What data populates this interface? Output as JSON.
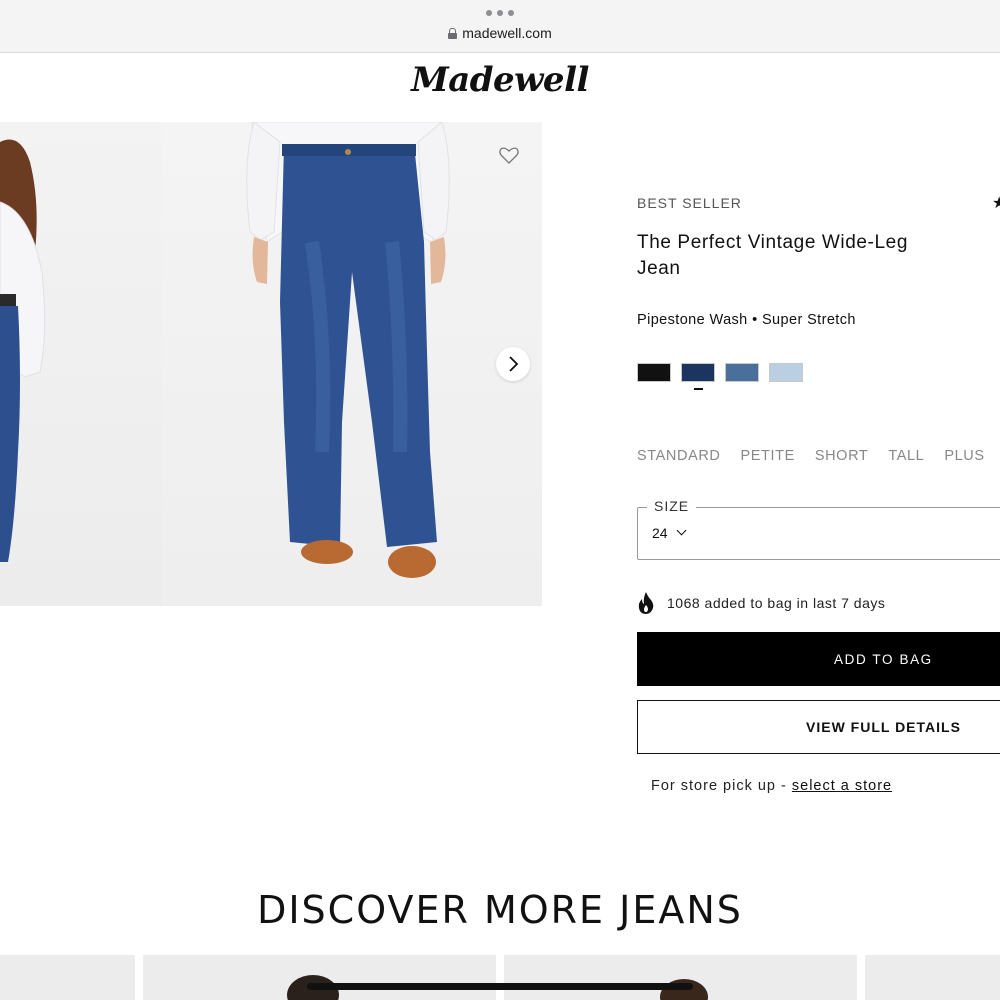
{
  "browser": {
    "url": "madewell.com",
    "menu_icon": "more-dots-icon",
    "lock_icon": "lock-icon"
  },
  "brand": {
    "logo": "Madewell"
  },
  "gallery": {
    "favorite_icon": "heart-icon",
    "next_icon": "chevron-right-icon"
  },
  "product": {
    "badge": "BEST SELLER",
    "title": "The Perfect Vintage Wide-Leg Jean",
    "subtitle": "Pipestone Wash • Super Stretch",
    "swatches": [
      {
        "color": "#111111",
        "selected": false
      },
      {
        "color": "#1c3560",
        "selected": true
      },
      {
        "color": "#4a6f9a",
        "selected": false
      },
      {
        "color": "#b9cfe2",
        "selected": false
      }
    ],
    "fits": [
      "STANDARD",
      "PETITE",
      "SHORT",
      "TALL",
      "PLUS"
    ],
    "size": {
      "label": "SIZE",
      "value": "24"
    },
    "popularity": "1068 added to bag in last 7 days",
    "add_to_bag": "ADD TO BAG",
    "view_details": "VIEW FULL DETAILS",
    "store_prefix": "For store pick up - ",
    "store_link": "select a store"
  },
  "discover": {
    "heading": "DISCOVER MORE JEANS"
  },
  "colors": {
    "accent": "#000000",
    "text": "#111111",
    "muted": "#888888"
  }
}
